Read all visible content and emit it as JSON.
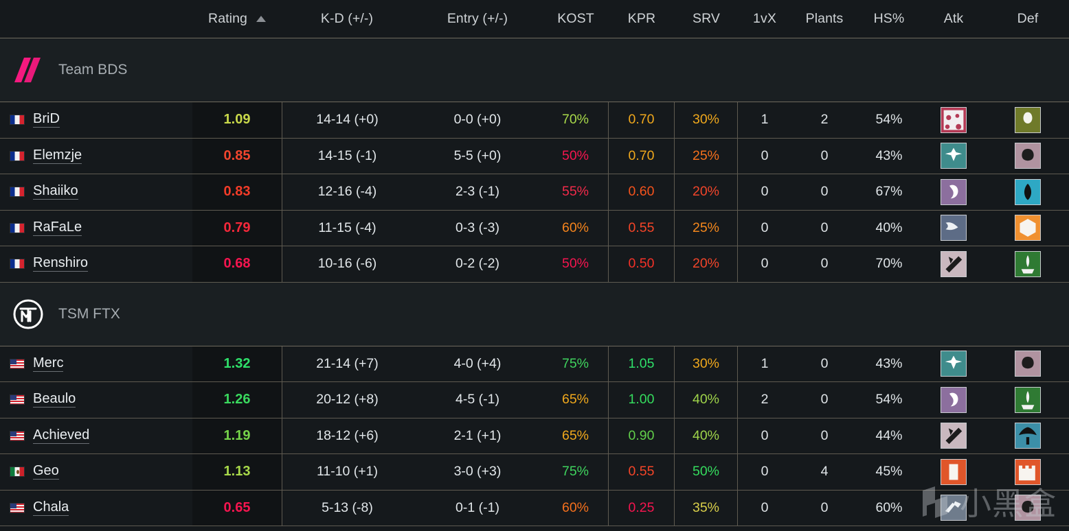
{
  "columns": {
    "player": "",
    "rating": "Rating",
    "sort_icon": "sort-ascending-icon",
    "kd": "K-D (+/-)",
    "entry": "Entry (+/-)",
    "kost": "KOST",
    "kpr": "KPR",
    "srv": "SRV",
    "onevx": "1vX",
    "plants": "Plants",
    "hs": "HS%",
    "atk": "Atk",
    "def": "Def"
  },
  "colors": {
    "background": "#15191c",
    "rating_column_bg": "#101315",
    "team_band_bg": "#1a1f22",
    "grid_line": "#5f5b51",
    "header_line": "#6f6a5e",
    "bds_pink": "#f5197f",
    "green": "#2fe06a",
    "yellow_green": "#c9d94a",
    "orange": "#f59a17",
    "red": "#f03a2a",
    "crimson": "#f5154f"
  },
  "teams": [
    {
      "name": "Team BDS",
      "logo": "bds-logo",
      "players": [
        {
          "name": "BriD",
          "flag": "flag-fr",
          "country": "France",
          "rating": "1.09",
          "rating_color": "#c9d94a",
          "kd": "14-14 (+0)",
          "entry": "0-0 (+0)",
          "kost": "70%",
          "kost_color": "#a8d94a",
          "kpr": "0.70",
          "kpr_color": "#f0a81c",
          "srv": "30%",
          "srv_color": "#f0a81c",
          "onevx": "1",
          "plants": "2",
          "hs": "54%",
          "atk_op": "jackal",
          "def_op": "echo"
        },
        {
          "name": "Elemzje",
          "flag": "flag-fr",
          "country": "France",
          "rating": "0.85",
          "rating_color": "#f2462e",
          "kd": "14-15 (-1)",
          "entry": "5-5 (+0)",
          "kost": "50%",
          "kost_color": "#f5154f",
          "kpr": "0.70",
          "kpr_color": "#f0a81c",
          "srv": "25%",
          "srv_color": "#f5701c",
          "onevx": "0",
          "plants": "0",
          "hs": "43%",
          "atk_op": "nomad",
          "def_op": "caveira"
        },
        {
          "name": "Shaiiko",
          "flag": "flag-fr",
          "country": "France",
          "rating": "0.83",
          "rating_color": "#f33c28",
          "kd": "12-16 (-4)",
          "entry": "2-3 (-1)",
          "kost": "55%",
          "kost_color": "#f22a4a",
          "kpr": "0.60",
          "kpr_color": "#f5531c",
          "srv": "20%",
          "srv_color": "#f2452a",
          "onevx": "0",
          "plants": "0",
          "hs": "67%",
          "atk_op": "zofia",
          "def_op": "jager"
        },
        {
          "name": "RaFaLe",
          "flag": "flag-fr",
          "country": "France",
          "rating": "0.79",
          "rating_color": "#f5283a",
          "kd": "11-15 (-4)",
          "entry": "0-3 (-3)",
          "kost": "60%",
          "kost_color": "#f5841c",
          "kpr": "0.55",
          "kpr_color": "#f54528",
          "srv": "25%",
          "srv_color": "#f5881c",
          "onevx": "0",
          "plants": "0",
          "hs": "40%",
          "atk_op": "dokkaebi",
          "def_op": "mute"
        },
        {
          "name": "Renshiro",
          "flag": "flag-fr",
          "country": "France",
          "rating": "0.68",
          "rating_color": "#f5154f",
          "kd": "10-16 (-6)",
          "entry": "0-2 (-2)",
          "kost": "50%",
          "kost_color": "#f5154f",
          "kpr": "0.50",
          "kpr_color": "#f53128",
          "srv": "20%",
          "srv_color": "#f2452a",
          "onevx": "0",
          "plants": "0",
          "hs": "70%",
          "atk_op": "buck",
          "def_op": "kapkan"
        }
      ]
    },
    {
      "name": "TSM FTX",
      "logo": "tsm-logo",
      "players": [
        {
          "name": "Merc",
          "flag": "flag-us",
          "country": "United States",
          "rating": "1.32",
          "rating_color": "#2fe06a",
          "kd": "21-14 (+7)",
          "entry": "4-0 (+4)",
          "kost": "75%",
          "kost_color": "#3fd45e",
          "kpr": "1.05",
          "kpr_color": "#2fe06a",
          "srv": "30%",
          "srv_color": "#f0a81c",
          "onevx": "1",
          "plants": "0",
          "hs": "43%",
          "atk_op": "nomad",
          "def_op": "caveira"
        },
        {
          "name": "Beaulo",
          "flag": "flag-us",
          "country": "United States",
          "rating": "1.26",
          "rating_color": "#3ad95e",
          "kd": "20-12 (+8)",
          "entry": "4-5 (-1)",
          "kost": "65%",
          "kost_color": "#f0a81c",
          "kpr": "1.00",
          "kpr_color": "#35dd5e",
          "srv": "40%",
          "srv_color": "#9fd44a",
          "onevx": "2",
          "plants": "0",
          "hs": "54%",
          "atk_op": "zofia",
          "def_op": "kapkan"
        },
        {
          "name": "Achieved",
          "flag": "flag-us",
          "country": "United States",
          "rating": "1.19",
          "rating_color": "#76d44a",
          "kd": "18-12 (+6)",
          "entry": "2-1 (+1)",
          "kost": "65%",
          "kost_color": "#f0a81c",
          "kpr": "0.90",
          "kpr_color": "#62cf4a",
          "srv": "40%",
          "srv_color": "#9fd44a",
          "onevx": "0",
          "plants": "0",
          "hs": "44%",
          "atk_op": "buck",
          "def_op": "smoke"
        },
        {
          "name": "Geo",
          "flag": "flag-mx",
          "country": "Mexico",
          "rating": "1.13",
          "rating_color": "#a8d94a",
          "kd": "11-10 (+1)",
          "entry": "3-0 (+3)",
          "kost": "75%",
          "kost_color": "#3fd45e",
          "kpr": "0.55",
          "kpr_color": "#f54528",
          "srv": "50%",
          "srv_color": "#35dd5e",
          "onevx": "0",
          "plants": "4",
          "hs": "45%",
          "atk_op": "hibana",
          "def_op": "castle"
        },
        {
          "name": "Chala",
          "flag": "flag-us",
          "country": "United States",
          "rating": "0.65",
          "rating_color": "#f5154f",
          "kd": "5-13 (-8)",
          "entry": "0-1 (-1)",
          "kost": "60%",
          "kost_color": "#f5701c",
          "kpr": "0.25",
          "kpr_color": "#f5154f",
          "srv": "35%",
          "srv_color": "#d9cf4a",
          "onevx": "0",
          "plants": "0",
          "hs": "60%",
          "atk_op": "ash",
          "def_op": "caveira"
        }
      ]
    }
  ],
  "watermark": {
    "text": "小黑盒",
    "logo": "heybox-logo"
  }
}
